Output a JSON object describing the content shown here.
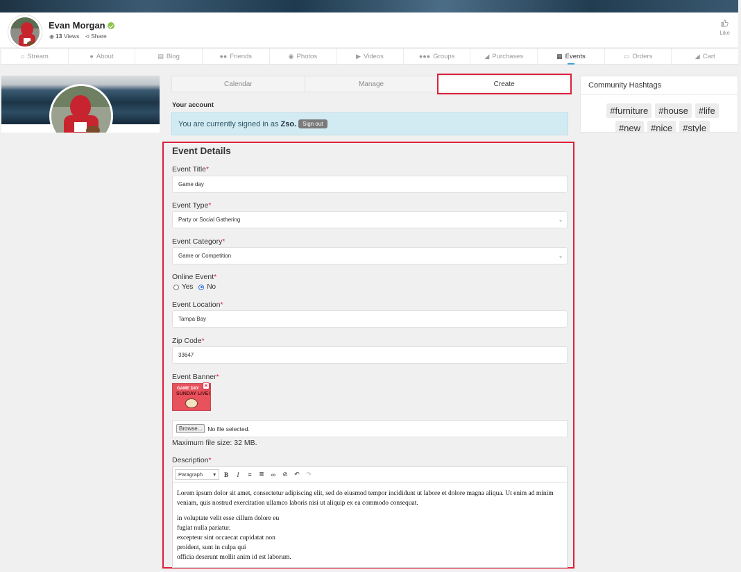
{
  "profile": {
    "name": "Evan Morgan",
    "views_count": "13",
    "views_label": "Views",
    "share_label": "Share",
    "like_label": "Like"
  },
  "nav": [
    {
      "label": "Stream",
      "icon": "home-icon"
    },
    {
      "label": "About",
      "icon": "user-icon"
    },
    {
      "label": "Blog",
      "icon": "newspaper-icon"
    },
    {
      "label": "Friends",
      "icon": "friends-icon"
    },
    {
      "label": "Photos",
      "icon": "camera-icon"
    },
    {
      "label": "Videos",
      "icon": "video-icon"
    },
    {
      "label": "Groups",
      "icon": "groups-icon"
    },
    {
      "label": "Purchases",
      "icon": "cart-icon"
    },
    {
      "label": "Events",
      "icon": "calendar-icon",
      "active": true
    },
    {
      "label": "Orders",
      "icon": "credit-card-icon"
    },
    {
      "label": "Cart",
      "icon": "cart-icon"
    }
  ],
  "tabs": {
    "calendar": "Calendar",
    "manage": "Manage",
    "create": "Create",
    "active": "create"
  },
  "account": {
    "title": "Your account",
    "signed_in_text": "You are currently signed in as",
    "username": "Zso.",
    "sign_out": "Sign out"
  },
  "form": {
    "title": "Event Details",
    "event_title": {
      "label": "Event Title",
      "value": "Game day"
    },
    "event_type": {
      "label": "Event Type",
      "value": "Party or Social Gathering"
    },
    "event_category": {
      "label": "Event Category",
      "value": "Game or Competition"
    },
    "online_event": {
      "label": "Online Event",
      "yes": "Yes",
      "no": "No",
      "selected": "No"
    },
    "event_location": {
      "label": "Event Location",
      "value": "Tampa Bay"
    },
    "zip_code": {
      "label": "Zip Code",
      "value": "33647"
    },
    "event_banner": {
      "label": "Event Banner",
      "thumb_line1": "GAME DAY",
      "thumb_line2": "SUNDAY LIVE!"
    },
    "file": {
      "browse": "Browse...",
      "status": "No file selected.",
      "max_size": "Maximum file size: 32 MB."
    },
    "description": {
      "label": "Description",
      "format": "Paragraph",
      "paragraph1": "Lorem ipsum dolor sit amet, consectetur adipiscing elit, sed do eiusmod tempor incididunt ut labore et dolore magna aliqua. Ut enim ad minim veniam, quis nostrud exercitation ullamco laboris nisi ut aliquip ex ea commodo consequat.",
      "lines": [
        "in voluptate velit esse cillum dolore eu",
        "fugiat nulla pariatur.",
        "excepteur sint occaecat cupidatat non",
        "proident, sunt in culpa qui",
        "officia deserunt mollit anim id est laborum."
      ]
    },
    "required_mark": "*"
  },
  "hashtags": {
    "title": "Community Hashtags",
    "tags": [
      "#furniture",
      "#house",
      "#life",
      "#new",
      "#nice",
      "#style"
    ]
  },
  "colors": {
    "highlight": "#dd1f3a",
    "nav_active_indicator": "#3ba3d5",
    "alert_bg": "#d2eaf1",
    "verified": "#8bc34a"
  }
}
